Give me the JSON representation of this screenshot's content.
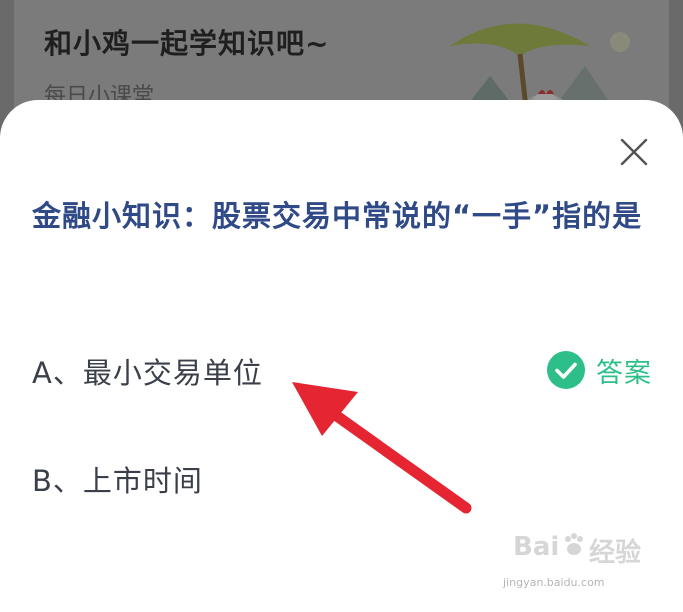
{
  "background": {
    "title": "和小鸡一起学知识吧~",
    "subtitle": "每日小课堂"
  },
  "modal": {
    "close_icon": "close-icon",
    "question": "金融小知识：股票交易中常说的“一手”指的是",
    "options": [
      {
        "label": "A、最小交易单位",
        "is_answer": true
      },
      {
        "label": "B、上市时间",
        "is_answer": false
      }
    ],
    "answer_label": "答案",
    "answer_icon": "check-circle-icon",
    "colors": {
      "question": "#2f4a86",
      "answer": "#2dbe8a",
      "arrow": "#e52532"
    }
  },
  "watermark": {
    "brand": "Bai",
    "brand_suffix": "经验",
    "url": "jingyan.baidu.com"
  }
}
